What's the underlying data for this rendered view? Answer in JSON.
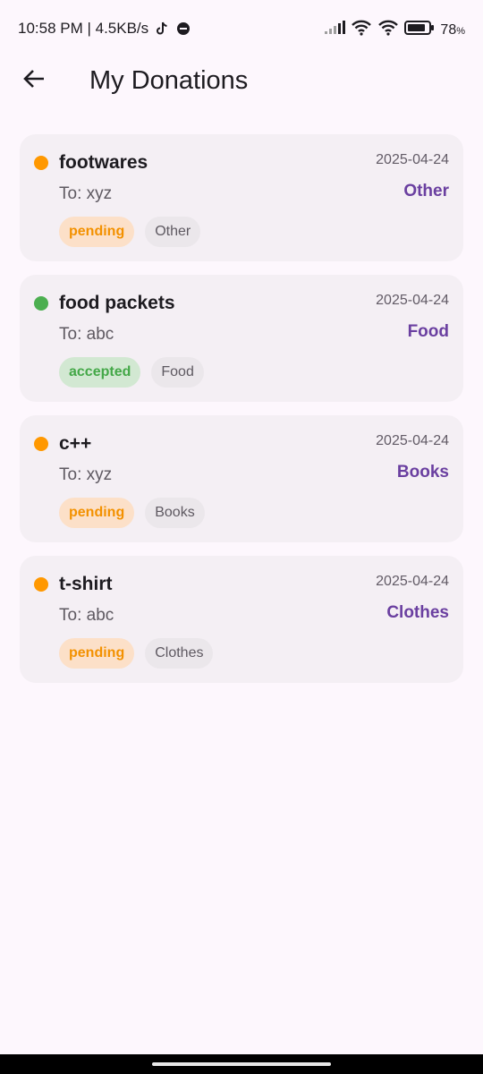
{
  "status_bar": {
    "time_speed": "10:58 PM | 4.5KB/s",
    "battery": "78",
    "battery_unit": "%"
  },
  "app_bar": {
    "title": "My Donations"
  },
  "donations": [
    {
      "title": "footwares",
      "date": "2025-04-24",
      "recipient": "To: xyz",
      "category": "Other",
      "status": "pending",
      "category_chip": "Other",
      "status_color": "#ff9800",
      "chip_bg": "#fce0c8",
      "chip_text": "#f39100"
    },
    {
      "title": "food packets",
      "date": "2025-04-24",
      "recipient": "To: abc",
      "category": "Food",
      "status": "accepted",
      "category_chip": "Food",
      "status_color": "#4caf50",
      "chip_bg": "#d2e8d2",
      "chip_text": "#44a848"
    },
    {
      "title": "c++",
      "date": "2025-04-24",
      "recipient": "To: xyz",
      "category": "Books",
      "status": "pending",
      "category_chip": "Books",
      "status_color": "#ff9800",
      "chip_bg": "#fce0c8",
      "chip_text": "#f39100"
    },
    {
      "title": "t-shirt",
      "date": "2025-04-24",
      "recipient": "To: abc",
      "category": "Clothes",
      "status": "pending",
      "category_chip": "Clothes",
      "status_color": "#ff9800",
      "chip_bg": "#fce0c8",
      "chip_text": "#f39100"
    }
  ],
  "icons": {
    "back": "arrow-back-icon",
    "status_left": [
      "tiktok-icon",
      "notification-icon"
    ],
    "status_right": [
      "signal-icon",
      "wifi-icon",
      "wifi-icon",
      "battery-icon"
    ]
  },
  "colors": {
    "background": "#fdf7fd",
    "card": "#f4eff4",
    "accent": "#6a3fa0"
  }
}
